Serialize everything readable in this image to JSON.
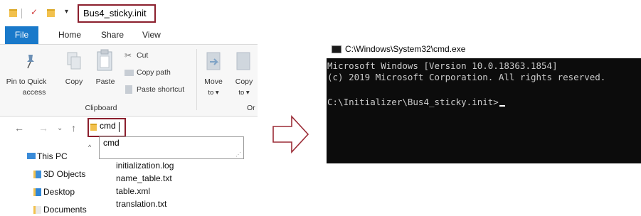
{
  "explorer": {
    "title": "Bus4_sticky.init",
    "tabs": [
      "File",
      "Home",
      "Share",
      "View"
    ],
    "ribbon": {
      "pin_label_1": "Pin to Quick",
      "pin_label_2": "access",
      "copy": "Copy",
      "paste": "Paste",
      "cut": "Cut",
      "copy_path": "Copy path",
      "paste_shortcut": "Paste shortcut",
      "move_to_1": "Move",
      "move_to_2": "to ▾",
      "copy_to_1": "Copy",
      "copy_to_2": "to ▾",
      "organize_partial": "Or",
      "clipboard_group": "Clipboard"
    },
    "address": {
      "value": "cmd"
    },
    "autocomplete": [
      "cmd"
    ],
    "nav_pane": [
      "This PC",
      "3D Objects",
      "Desktop",
      "Documents"
    ],
    "files": [
      "initialization.log",
      "name_table.txt",
      "table.xml",
      "translation.txt"
    ]
  },
  "cmd": {
    "title": "C:\\Windows\\System32\\cmd.exe",
    "lines": [
      "Microsoft Windows [Version 10.0.18363.1854]",
      "(c) 2019 Microsoft Corporation. All rights reserved.",
      "",
      "C:\\Initializer\\Bus4_sticky.init>"
    ]
  }
}
